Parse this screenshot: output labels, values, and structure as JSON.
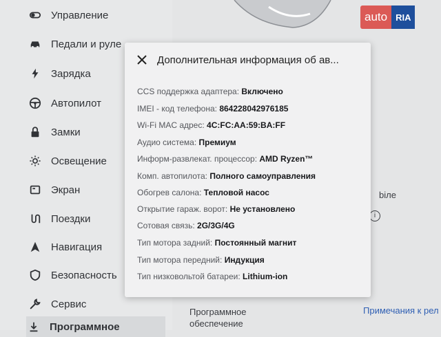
{
  "sidebar": {
    "items": [
      {
        "label": "Управление",
        "icon": "toggle-icon"
      },
      {
        "label": "Педали и руле",
        "icon": "car-icon"
      },
      {
        "label": "Зарядка",
        "icon": "bolt-icon"
      },
      {
        "label": "Автопилот",
        "icon": "steering-wheel-icon"
      },
      {
        "label": "Замки",
        "icon": "lock-icon"
      },
      {
        "label": "Освещение",
        "icon": "sun-icon"
      },
      {
        "label": "Экран",
        "icon": "display-icon"
      },
      {
        "label": "Поездки",
        "icon": "trip-icon"
      },
      {
        "label": "Навигация",
        "icon": "navigation-icon"
      },
      {
        "label": "Безопасность",
        "icon": "shield-icon"
      },
      {
        "label": "Сервис",
        "icon": "wrench-icon"
      },
      {
        "label": "Программное",
        "icon": "download-icon"
      }
    ]
  },
  "background": {
    "software_heading_line1": "Программное",
    "software_heading_line2": "обеспечение",
    "release_notes_link": "Примечания к рел",
    "partial_text": "biле",
    "info_icon_char": "i"
  },
  "logo": {
    "part1": "auto",
    "part2": "RIA"
  },
  "modal": {
    "title": "Дополнительная информация об ав...",
    "rows": [
      {
        "label": "CCS поддержка адаптера:",
        "value": "Включено"
      },
      {
        "label": "IMEI - код телефона:",
        "value": "864228042976185"
      },
      {
        "label": "Wi-Fi MAC адрес:",
        "value": "4C:FC:AA:59:BA:FF"
      },
      {
        "label": "Аудио система:",
        "value": "Премиум"
      },
      {
        "label": "Информ-развлекат. процессор:",
        "value": "AMD Ryzen™"
      },
      {
        "label": "Комп. автопилота:",
        "value": "Полного самоуправления"
      },
      {
        "label": "Обогрев салона:",
        "value": "Тепловой насос"
      },
      {
        "label": "Открытие гараж. ворот:",
        "value": "Не установлено"
      },
      {
        "label": "Сотовая связь:",
        "value": "2G/3G/4G"
      },
      {
        "label": "Тип мотора задний:",
        "value": "Постоянный магнит"
      },
      {
        "label": "Тип мотора передний:",
        "value": "Индукция"
      },
      {
        "label": "Тип низковольтой батареи:",
        "value": "Lithium-ion"
      }
    ]
  }
}
